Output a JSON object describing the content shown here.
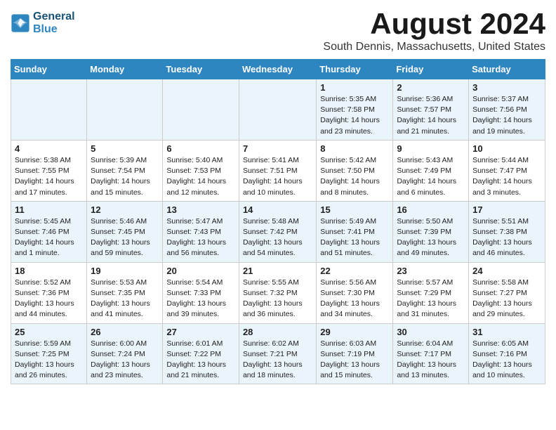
{
  "logo": {
    "line1": "General",
    "line2": "Blue"
  },
  "title": "August 2024",
  "subtitle": "South Dennis, Massachusetts, United States",
  "weekdays": [
    "Sunday",
    "Monday",
    "Tuesday",
    "Wednesday",
    "Thursday",
    "Friday",
    "Saturday"
  ],
  "weeks": [
    [
      {
        "day": "",
        "info": ""
      },
      {
        "day": "",
        "info": ""
      },
      {
        "day": "",
        "info": ""
      },
      {
        "day": "",
        "info": ""
      },
      {
        "day": "1",
        "info": "Sunrise: 5:35 AM\nSunset: 7:58 PM\nDaylight: 14 hours\nand 23 minutes."
      },
      {
        "day": "2",
        "info": "Sunrise: 5:36 AM\nSunset: 7:57 PM\nDaylight: 14 hours\nand 21 minutes."
      },
      {
        "day": "3",
        "info": "Sunrise: 5:37 AM\nSunset: 7:56 PM\nDaylight: 14 hours\nand 19 minutes."
      }
    ],
    [
      {
        "day": "4",
        "info": "Sunrise: 5:38 AM\nSunset: 7:55 PM\nDaylight: 14 hours\nand 17 minutes."
      },
      {
        "day": "5",
        "info": "Sunrise: 5:39 AM\nSunset: 7:54 PM\nDaylight: 14 hours\nand 15 minutes."
      },
      {
        "day": "6",
        "info": "Sunrise: 5:40 AM\nSunset: 7:53 PM\nDaylight: 14 hours\nand 12 minutes."
      },
      {
        "day": "7",
        "info": "Sunrise: 5:41 AM\nSunset: 7:51 PM\nDaylight: 14 hours\nand 10 minutes."
      },
      {
        "day": "8",
        "info": "Sunrise: 5:42 AM\nSunset: 7:50 PM\nDaylight: 14 hours\nand 8 minutes."
      },
      {
        "day": "9",
        "info": "Sunrise: 5:43 AM\nSunset: 7:49 PM\nDaylight: 14 hours\nand 6 minutes."
      },
      {
        "day": "10",
        "info": "Sunrise: 5:44 AM\nSunset: 7:47 PM\nDaylight: 14 hours\nand 3 minutes."
      }
    ],
    [
      {
        "day": "11",
        "info": "Sunrise: 5:45 AM\nSunset: 7:46 PM\nDaylight: 14 hours\nand 1 minute."
      },
      {
        "day": "12",
        "info": "Sunrise: 5:46 AM\nSunset: 7:45 PM\nDaylight: 13 hours\nand 59 minutes."
      },
      {
        "day": "13",
        "info": "Sunrise: 5:47 AM\nSunset: 7:43 PM\nDaylight: 13 hours\nand 56 minutes."
      },
      {
        "day": "14",
        "info": "Sunrise: 5:48 AM\nSunset: 7:42 PM\nDaylight: 13 hours\nand 54 minutes."
      },
      {
        "day": "15",
        "info": "Sunrise: 5:49 AM\nSunset: 7:41 PM\nDaylight: 13 hours\nand 51 minutes."
      },
      {
        "day": "16",
        "info": "Sunrise: 5:50 AM\nSunset: 7:39 PM\nDaylight: 13 hours\nand 49 minutes."
      },
      {
        "day": "17",
        "info": "Sunrise: 5:51 AM\nSunset: 7:38 PM\nDaylight: 13 hours\nand 46 minutes."
      }
    ],
    [
      {
        "day": "18",
        "info": "Sunrise: 5:52 AM\nSunset: 7:36 PM\nDaylight: 13 hours\nand 44 minutes."
      },
      {
        "day": "19",
        "info": "Sunrise: 5:53 AM\nSunset: 7:35 PM\nDaylight: 13 hours\nand 41 minutes."
      },
      {
        "day": "20",
        "info": "Sunrise: 5:54 AM\nSunset: 7:33 PM\nDaylight: 13 hours\nand 39 minutes."
      },
      {
        "day": "21",
        "info": "Sunrise: 5:55 AM\nSunset: 7:32 PM\nDaylight: 13 hours\nand 36 minutes."
      },
      {
        "day": "22",
        "info": "Sunrise: 5:56 AM\nSunset: 7:30 PM\nDaylight: 13 hours\nand 34 minutes."
      },
      {
        "day": "23",
        "info": "Sunrise: 5:57 AM\nSunset: 7:29 PM\nDaylight: 13 hours\nand 31 minutes."
      },
      {
        "day": "24",
        "info": "Sunrise: 5:58 AM\nSunset: 7:27 PM\nDaylight: 13 hours\nand 29 minutes."
      }
    ],
    [
      {
        "day": "25",
        "info": "Sunrise: 5:59 AM\nSunset: 7:25 PM\nDaylight: 13 hours\nand 26 minutes."
      },
      {
        "day": "26",
        "info": "Sunrise: 6:00 AM\nSunset: 7:24 PM\nDaylight: 13 hours\nand 23 minutes."
      },
      {
        "day": "27",
        "info": "Sunrise: 6:01 AM\nSunset: 7:22 PM\nDaylight: 13 hours\nand 21 minutes."
      },
      {
        "day": "28",
        "info": "Sunrise: 6:02 AM\nSunset: 7:21 PM\nDaylight: 13 hours\nand 18 minutes."
      },
      {
        "day": "29",
        "info": "Sunrise: 6:03 AM\nSunset: 7:19 PM\nDaylight: 13 hours\nand 15 minutes."
      },
      {
        "day": "30",
        "info": "Sunrise: 6:04 AM\nSunset: 7:17 PM\nDaylight: 13 hours\nand 13 minutes."
      },
      {
        "day": "31",
        "info": "Sunrise: 6:05 AM\nSunset: 7:16 PM\nDaylight: 13 hours\nand 10 minutes."
      }
    ]
  ]
}
